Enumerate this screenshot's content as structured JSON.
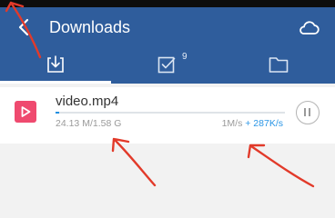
{
  "app_bar": {
    "title": "Downloads",
    "back_icon": "chevron-left-icon",
    "cloud_icon": "cloud-icon"
  },
  "tabs": [
    {
      "icon": "download-icon",
      "active": true
    },
    {
      "icon": "checked-box-icon",
      "badge": "9",
      "active": false
    },
    {
      "icon": "folder-icon",
      "active": false
    }
  ],
  "download": {
    "file_name": "video.mp4",
    "file_icon": "video-play-icon",
    "downloaded": "24.13 M/1.58 G",
    "progress_fraction": 0.015,
    "speed": "1M/s",
    "speed_extra": "+ 287K/s",
    "action_icon": "pause-icon"
  },
  "annotations": {
    "color": "#e23a2a"
  },
  "colors": {
    "header": "#2f5d9c",
    "accent": "#1e8fe1",
    "file_icon_bg": "#ef4a6f",
    "background": "#f2f2f2"
  }
}
